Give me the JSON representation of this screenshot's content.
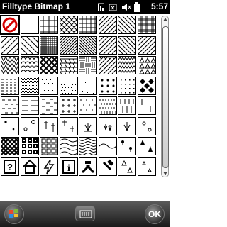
{
  "status": {
    "title": "Filltype Bitmap 1",
    "time": "5:57",
    "icons": [
      "windows-start-icon",
      "signal-icon",
      "sync-icon",
      "volume-icon",
      "battery-icon"
    ]
  },
  "patterns": {
    "rows": [
      [
        "none",
        "solid-blank",
        "brick-vertical",
        "diag-cross",
        "grid-large",
        "diag-forward",
        "diag-backward",
        "grid-double"
      ],
      [
        "diag-forward-wide",
        "diag-backward-wide",
        "grid-fine",
        "diag-forward-dense",
        "diag-backward-dense",
        "diag-forward",
        "diag-backward",
        "diag-forward"
      ],
      [
        "herringbone",
        "scales",
        "crosshatch-bold",
        "shingles",
        "basket",
        "brick-diagonal",
        "zigzag",
        "triangles"
      ],
      [
        "dashes-short",
        "stipple-dense",
        "dots-sparse",
        "dots-medium",
        "dots-random",
        "dots-large",
        "dots-grid",
        "diamonds-filled"
      ],
      [
        "dashes-rows",
        "dashes-long",
        "dash-offset",
        "dash-cross",
        "ticks-vertical",
        "ticks-vertical-dense",
        "bars-vertical",
        "bars-sparse"
      ],
      [
        "dots-small",
        "circles",
        "crosses-tall",
        "crosses",
        "marsh",
        "marsh-tuft",
        "tuft",
        "dots-hollow"
      ],
      [
        "weave",
        "tiles-black",
        "checker-square",
        "waves",
        "waves-dense",
        "wave-line",
        "trees-round",
        "trees-pine"
      ],
      [
        "symbol-question",
        "symbol-house",
        "symbol-lightning",
        "symbol-info",
        "symbol-tools",
        "symbol-hammer",
        "symbol-triangles",
        "symbol-triangles-small"
      ]
    ]
  },
  "softkeys": {
    "ok_label": "OK",
    "start_icon": "windows-start-icon",
    "keyboard_icon": "keyboard-icon"
  }
}
